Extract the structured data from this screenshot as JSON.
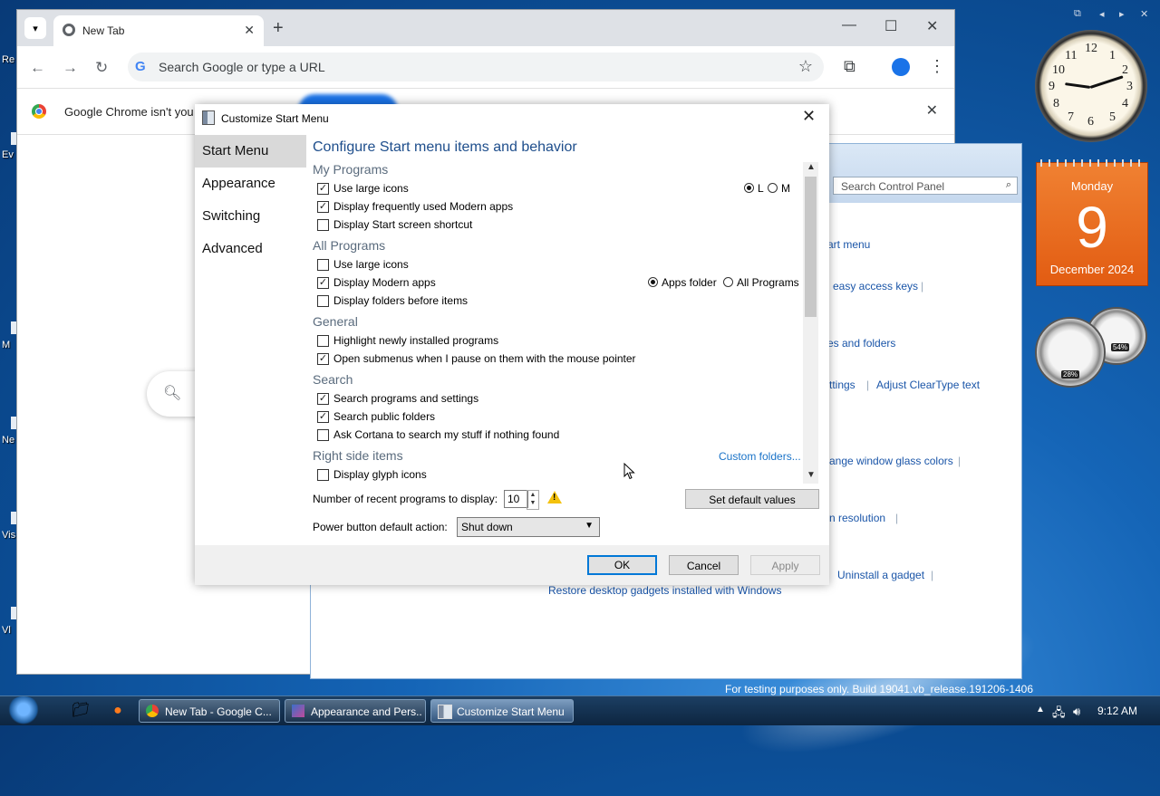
{
  "chrome": {
    "tab_title": "New Tab",
    "new_tab": "+",
    "omnibox_placeholder": "Search Google or type a URL",
    "infobar_message": "Google Chrome isn't you",
    "infobar_close": "✕"
  },
  "control_panel": {
    "search_placeholder": "Search Control Panel",
    "links": {
      "start_menu": "art menu",
      "access_keys": "easy access keys",
      "files_folders": "es and folders",
      "settings": "ttings",
      "cleartype": "Adjust ClearType text",
      "glass_colors": "ange window glass colors",
      "resolution": "n resolution",
      "uninstall_gadget": "Uninstall a gadget",
      "restore_gadgets": "Restore desktop gadgets installed with Windows"
    },
    "build_status": "For testing purposes only. Build 19041.vb_release.191206-1406"
  },
  "dialog": {
    "title": "Customize Start Menu",
    "nav": [
      "Start Menu",
      "Appearance",
      "Switching",
      "Advanced"
    ],
    "heading": "Configure Start menu items and behavior",
    "groups": {
      "my_programs": "My Programs",
      "all_programs": "All Programs",
      "general": "General",
      "search": "Search",
      "right_side": "Right side items"
    },
    "options": {
      "mp_large_icons": "Use large icons",
      "mp_modern_apps": "Display frequently used Modern apps",
      "mp_start_screen": "Display Start screen shortcut",
      "ap_large_icons": "Use large icons",
      "ap_modern_apps": "Display Modern apps",
      "ap_folders_first": "Display folders before items",
      "gen_highlight": "Highlight newly installed programs",
      "gen_submenus": "Open submenus when I pause on them with the mouse pointer",
      "s_programs": "Search programs and settings",
      "s_public": "Search public folders",
      "s_cortana": "Ask Cortana to search my stuff if nothing found",
      "r_glyph": "Display glyph icons"
    },
    "check_mark": "✓",
    "radios": {
      "size_l": "L",
      "size_m": "M",
      "apps_folder": "Apps folder",
      "all_programs": "All Programs"
    },
    "custom_folders": "Custom folders...",
    "recent_label": "Number of recent programs to display:",
    "recent_value": "10",
    "set_default": "Set default values",
    "power_label": "Power button default action:",
    "power_value": "Shut down",
    "ok": "OK",
    "cancel": "Cancel",
    "apply": "Apply"
  },
  "gadgets": {
    "calendar_day": "Monday",
    "calendar_date": "9",
    "calendar_month": "December 2024",
    "cpu_percent": "28%",
    "mem_percent": "54%",
    "clock_numbers": [
      "12",
      "1",
      "2",
      "3",
      "4",
      "5",
      "6",
      "7",
      "8",
      "9",
      "10",
      "11"
    ]
  },
  "taskbar": {
    "tasks": [
      "New Tab - Google C...",
      "Appearance and Pers...",
      "Customize Start Menu"
    ],
    "time": "9:12 AM"
  },
  "desktop_labels": [
    "Re",
    "Ev",
    "M",
    "Ne",
    "Vis",
    "Vl"
  ],
  "colors": {
    "accent": "#0078d7",
    "link": "#1a73c8",
    "calendar": "#ec7028"
  }
}
